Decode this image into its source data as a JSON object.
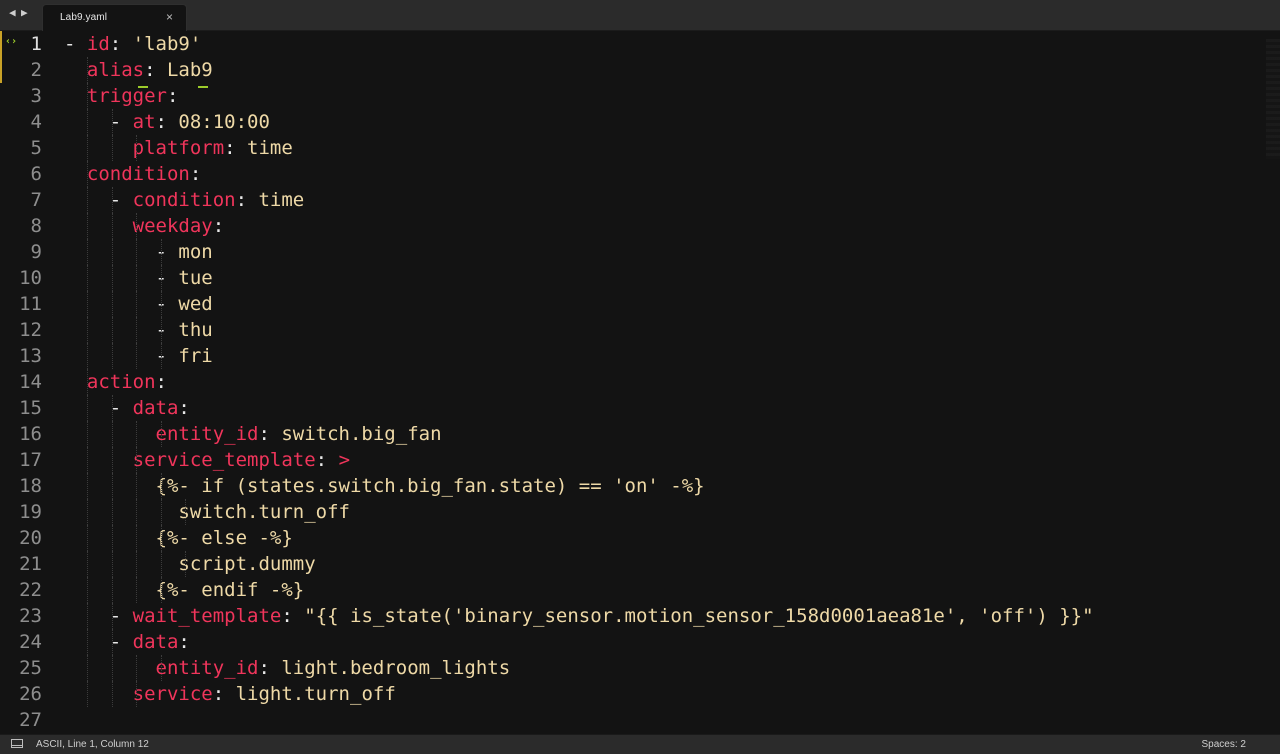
{
  "tabbar": {
    "back_glyph": "◀",
    "forward_glyph": "▶",
    "active_tab": {
      "label": "Lab9.yaml",
      "close_glyph": "×"
    }
  },
  "gutter": {
    "line_numbers": [
      "1",
      "2",
      "3",
      "4",
      "5",
      "6",
      "7",
      "8",
      "9",
      "10",
      "11",
      "12",
      "13",
      "14",
      "15",
      "16",
      "17",
      "18",
      "19",
      "20",
      "21",
      "22",
      "23",
      "24",
      "25",
      "26",
      "27"
    ],
    "current_line": 1,
    "modified_lines": [
      1,
      2
    ],
    "bracket_match_icon": "‹›"
  },
  "editor": {
    "lines": [
      [
        {
          "t": "- ",
          "c": "dash"
        },
        {
          "t": "id",
          "c": "key"
        },
        {
          "t": ": ",
          "c": "punct"
        },
        {
          "t": "'lab9'",
          "c": "str"
        }
      ],
      [
        {
          "t": "  ",
          "c": "plain"
        },
        {
          "t": "alias",
          "c": "key"
        },
        {
          "t": ": ",
          "c": "punct"
        },
        {
          "t": "Lab9",
          "c": "str"
        }
      ],
      [
        {
          "t": "  ",
          "c": "plain"
        },
        {
          "t": "trigger",
          "c": "key"
        },
        {
          "t": ":",
          "c": "punct"
        }
      ],
      [
        {
          "t": "    - ",
          "c": "dash"
        },
        {
          "t": "at",
          "c": "key"
        },
        {
          "t": ": ",
          "c": "punct"
        },
        {
          "t": "08:10:00",
          "c": "str"
        }
      ],
      [
        {
          "t": "      ",
          "c": "plain"
        },
        {
          "t": "platform",
          "c": "key"
        },
        {
          "t": ": ",
          "c": "punct"
        },
        {
          "t": "time",
          "c": "str"
        }
      ],
      [
        {
          "t": "  ",
          "c": "plain"
        },
        {
          "t": "condition",
          "c": "key"
        },
        {
          "t": ":",
          "c": "punct"
        }
      ],
      [
        {
          "t": "    - ",
          "c": "dash"
        },
        {
          "t": "condition",
          "c": "key"
        },
        {
          "t": ": ",
          "c": "punct"
        },
        {
          "t": "time",
          "c": "str"
        }
      ],
      [
        {
          "t": "      ",
          "c": "plain"
        },
        {
          "t": "weekday",
          "c": "key"
        },
        {
          "t": ":",
          "c": "punct"
        }
      ],
      [
        {
          "t": "        - ",
          "c": "dash"
        },
        {
          "t": "mon",
          "c": "str"
        }
      ],
      [
        {
          "t": "        - ",
          "c": "dash"
        },
        {
          "t": "tue",
          "c": "str"
        }
      ],
      [
        {
          "t": "        - ",
          "c": "dash"
        },
        {
          "t": "wed",
          "c": "str"
        }
      ],
      [
        {
          "t": "        - ",
          "c": "dash"
        },
        {
          "t": "thu",
          "c": "str"
        }
      ],
      [
        {
          "t": "        - ",
          "c": "dash"
        },
        {
          "t": "fri",
          "c": "str"
        }
      ],
      [
        {
          "t": "  ",
          "c": "plain"
        },
        {
          "t": "action",
          "c": "key"
        },
        {
          "t": ":",
          "c": "punct"
        }
      ],
      [
        {
          "t": "    - ",
          "c": "dash"
        },
        {
          "t": "data",
          "c": "key"
        },
        {
          "t": ":",
          "c": "punct"
        }
      ],
      [
        {
          "t": "        ",
          "c": "plain"
        },
        {
          "t": "entity_id",
          "c": "key"
        },
        {
          "t": ": ",
          "c": "punct"
        },
        {
          "t": "switch.big_fan",
          "c": "str"
        }
      ],
      [
        {
          "t": "      ",
          "c": "plain"
        },
        {
          "t": "service_template",
          "c": "key"
        },
        {
          "t": ": ",
          "c": "punct"
        },
        {
          "t": ">",
          "c": "op"
        }
      ],
      [
        {
          "t": "        ",
          "c": "plain"
        },
        {
          "t": "{%- if (states.switch.big_fan.state) == 'on' -%}",
          "c": "str"
        }
      ],
      [
        {
          "t": "          ",
          "c": "plain"
        },
        {
          "t": "switch.turn_off",
          "c": "str"
        }
      ],
      [
        {
          "t": "        ",
          "c": "plain"
        },
        {
          "t": "{%- else -%}",
          "c": "str"
        }
      ],
      [
        {
          "t": "          ",
          "c": "plain"
        },
        {
          "t": "script.dummy",
          "c": "str"
        }
      ],
      [
        {
          "t": "        ",
          "c": "plain"
        },
        {
          "t": "{%- endif -%}",
          "c": "str"
        }
      ],
      [
        {
          "t": "    - ",
          "c": "dash"
        },
        {
          "t": "wait_template",
          "c": "key"
        },
        {
          "t": ": ",
          "c": "punct"
        },
        {
          "t": "\"{{ is_state('binary_sensor.motion_sensor_158d0001aea81e', 'off') }}\"",
          "c": "str"
        }
      ],
      [
        {
          "t": "    - ",
          "c": "dash"
        },
        {
          "t": "data",
          "c": "key"
        },
        {
          "t": ":",
          "c": "punct"
        }
      ],
      [
        {
          "t": "        ",
          "c": "plain"
        },
        {
          "t": "entity_id",
          "c": "key"
        },
        {
          "t": ": ",
          "c": "punct"
        },
        {
          "t": "light.bedroom_lights",
          "c": "str"
        }
      ],
      [
        {
          "t": "      ",
          "c": "plain"
        },
        {
          "t": "service",
          "c": "key"
        },
        {
          "t": ": ",
          "c": "punct"
        },
        {
          "t": "light.turn_off",
          "c": "str"
        }
      ],
      []
    ]
  },
  "statusbar": {
    "left_text": "ASCII, Line 1, Column 12",
    "right_text": "Spaces: 2"
  },
  "colors": {
    "background": "#131313",
    "key": "#f0355b",
    "string": "#eed9a7",
    "bracket_match": "#9ccc2b",
    "modified_marker": "#c9a227"
  }
}
